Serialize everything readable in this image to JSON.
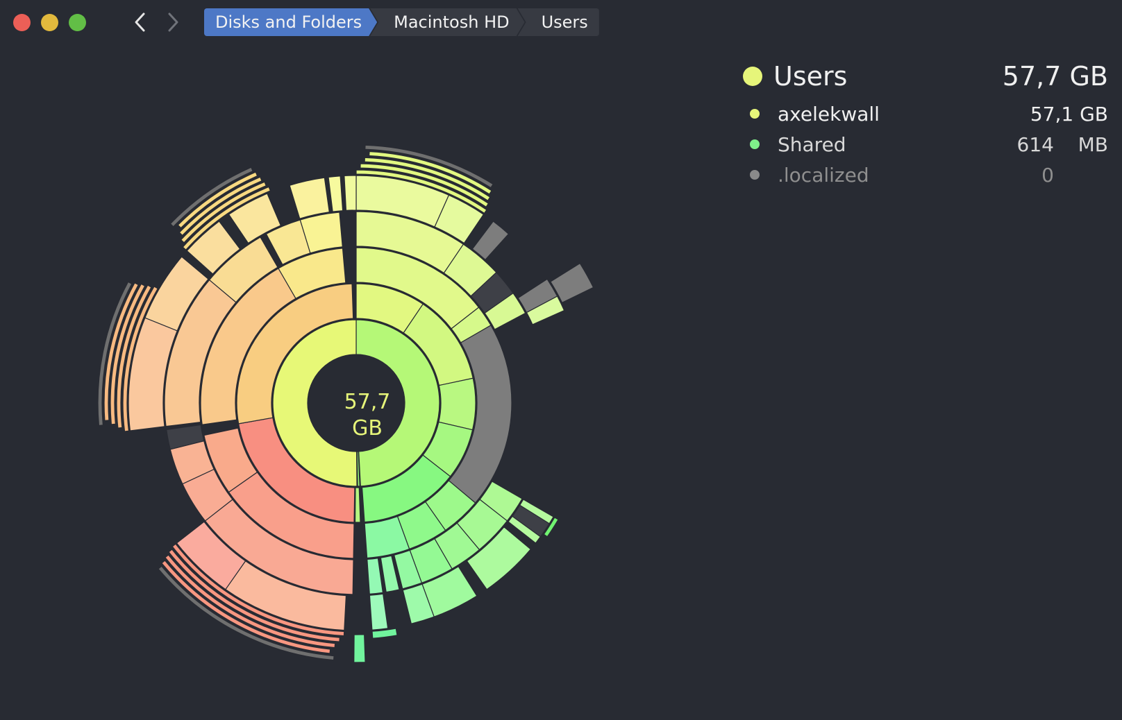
{
  "window": {
    "traffic_lights": [
      {
        "name": "close",
        "color": "#ec5f57"
      },
      {
        "name": "minimize",
        "color": "#e2b93d"
      },
      {
        "name": "zoom",
        "color": "#62be46"
      }
    ]
  },
  "navigation": {
    "back_icon": "chevron-left-icon",
    "forward_icon": "chevron-right-icon"
  },
  "breadcrumb": [
    {
      "label": "Disks and Folders"
    },
    {
      "label": "Macintosh HD"
    },
    {
      "label": "Users"
    }
  ],
  "center": {
    "value": "57,7",
    "unit": "GB"
  },
  "summary": {
    "title": "Users",
    "size": "57,7 GB",
    "color": "#e6f57a",
    "items": [
      {
        "name": "axelekwall",
        "value": "57,1 GB",
        "color": "#e6f57a",
        "text_color": "#f0f0f0"
      },
      {
        "name": "Shared",
        "value": "614",
        "unit": "MB",
        "color": "#7ff08a",
        "text_color": "#d8d8d8"
      },
      {
        "name": ".localized",
        "value": "0",
        "color": "#8a8a8a",
        "text_color": "#8f8f8f"
      }
    ]
  }
}
